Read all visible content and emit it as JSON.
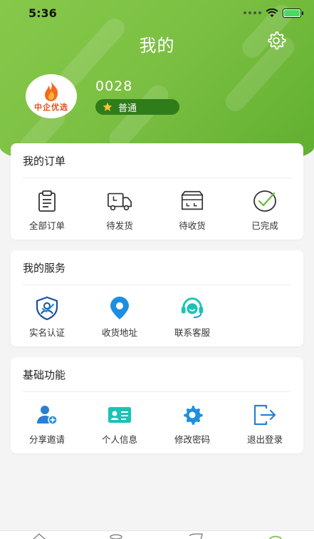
{
  "status_bar": {
    "time": "5:36"
  },
  "header": {
    "title": "我的"
  },
  "profile": {
    "username": "0028",
    "level": "普通",
    "avatar_text": "中企优选"
  },
  "orders": {
    "title": "我的订单",
    "items": [
      {
        "label": "全部订单",
        "icon": "clipboard-icon"
      },
      {
        "label": "待发货",
        "icon": "truck-icon"
      },
      {
        "label": "待收货",
        "icon": "box-icon"
      },
      {
        "label": "已完成",
        "icon": "check-circle-icon"
      }
    ]
  },
  "services": {
    "title": "我的服务",
    "items": [
      {
        "label": "实名认证",
        "icon": "shield-user-icon"
      },
      {
        "label": "收货地址",
        "icon": "location-pin-icon"
      },
      {
        "label": "联系客服",
        "icon": "headset-icon"
      }
    ]
  },
  "basic": {
    "title": "基础功能",
    "items": [
      {
        "label": "分享邀请",
        "icon": "add-user-icon"
      },
      {
        "label": "个人信息",
        "icon": "id-card-icon"
      },
      {
        "label": "修改密码",
        "icon": "gear-icon"
      },
      {
        "label": "退出登录",
        "icon": "logout-icon"
      }
    ]
  },
  "colors": {
    "brand_green": "#7cc043",
    "badge_green": "#2f7d1a",
    "icon_blue": "#1e8fe0",
    "icon_teal": "#19c3b6"
  }
}
